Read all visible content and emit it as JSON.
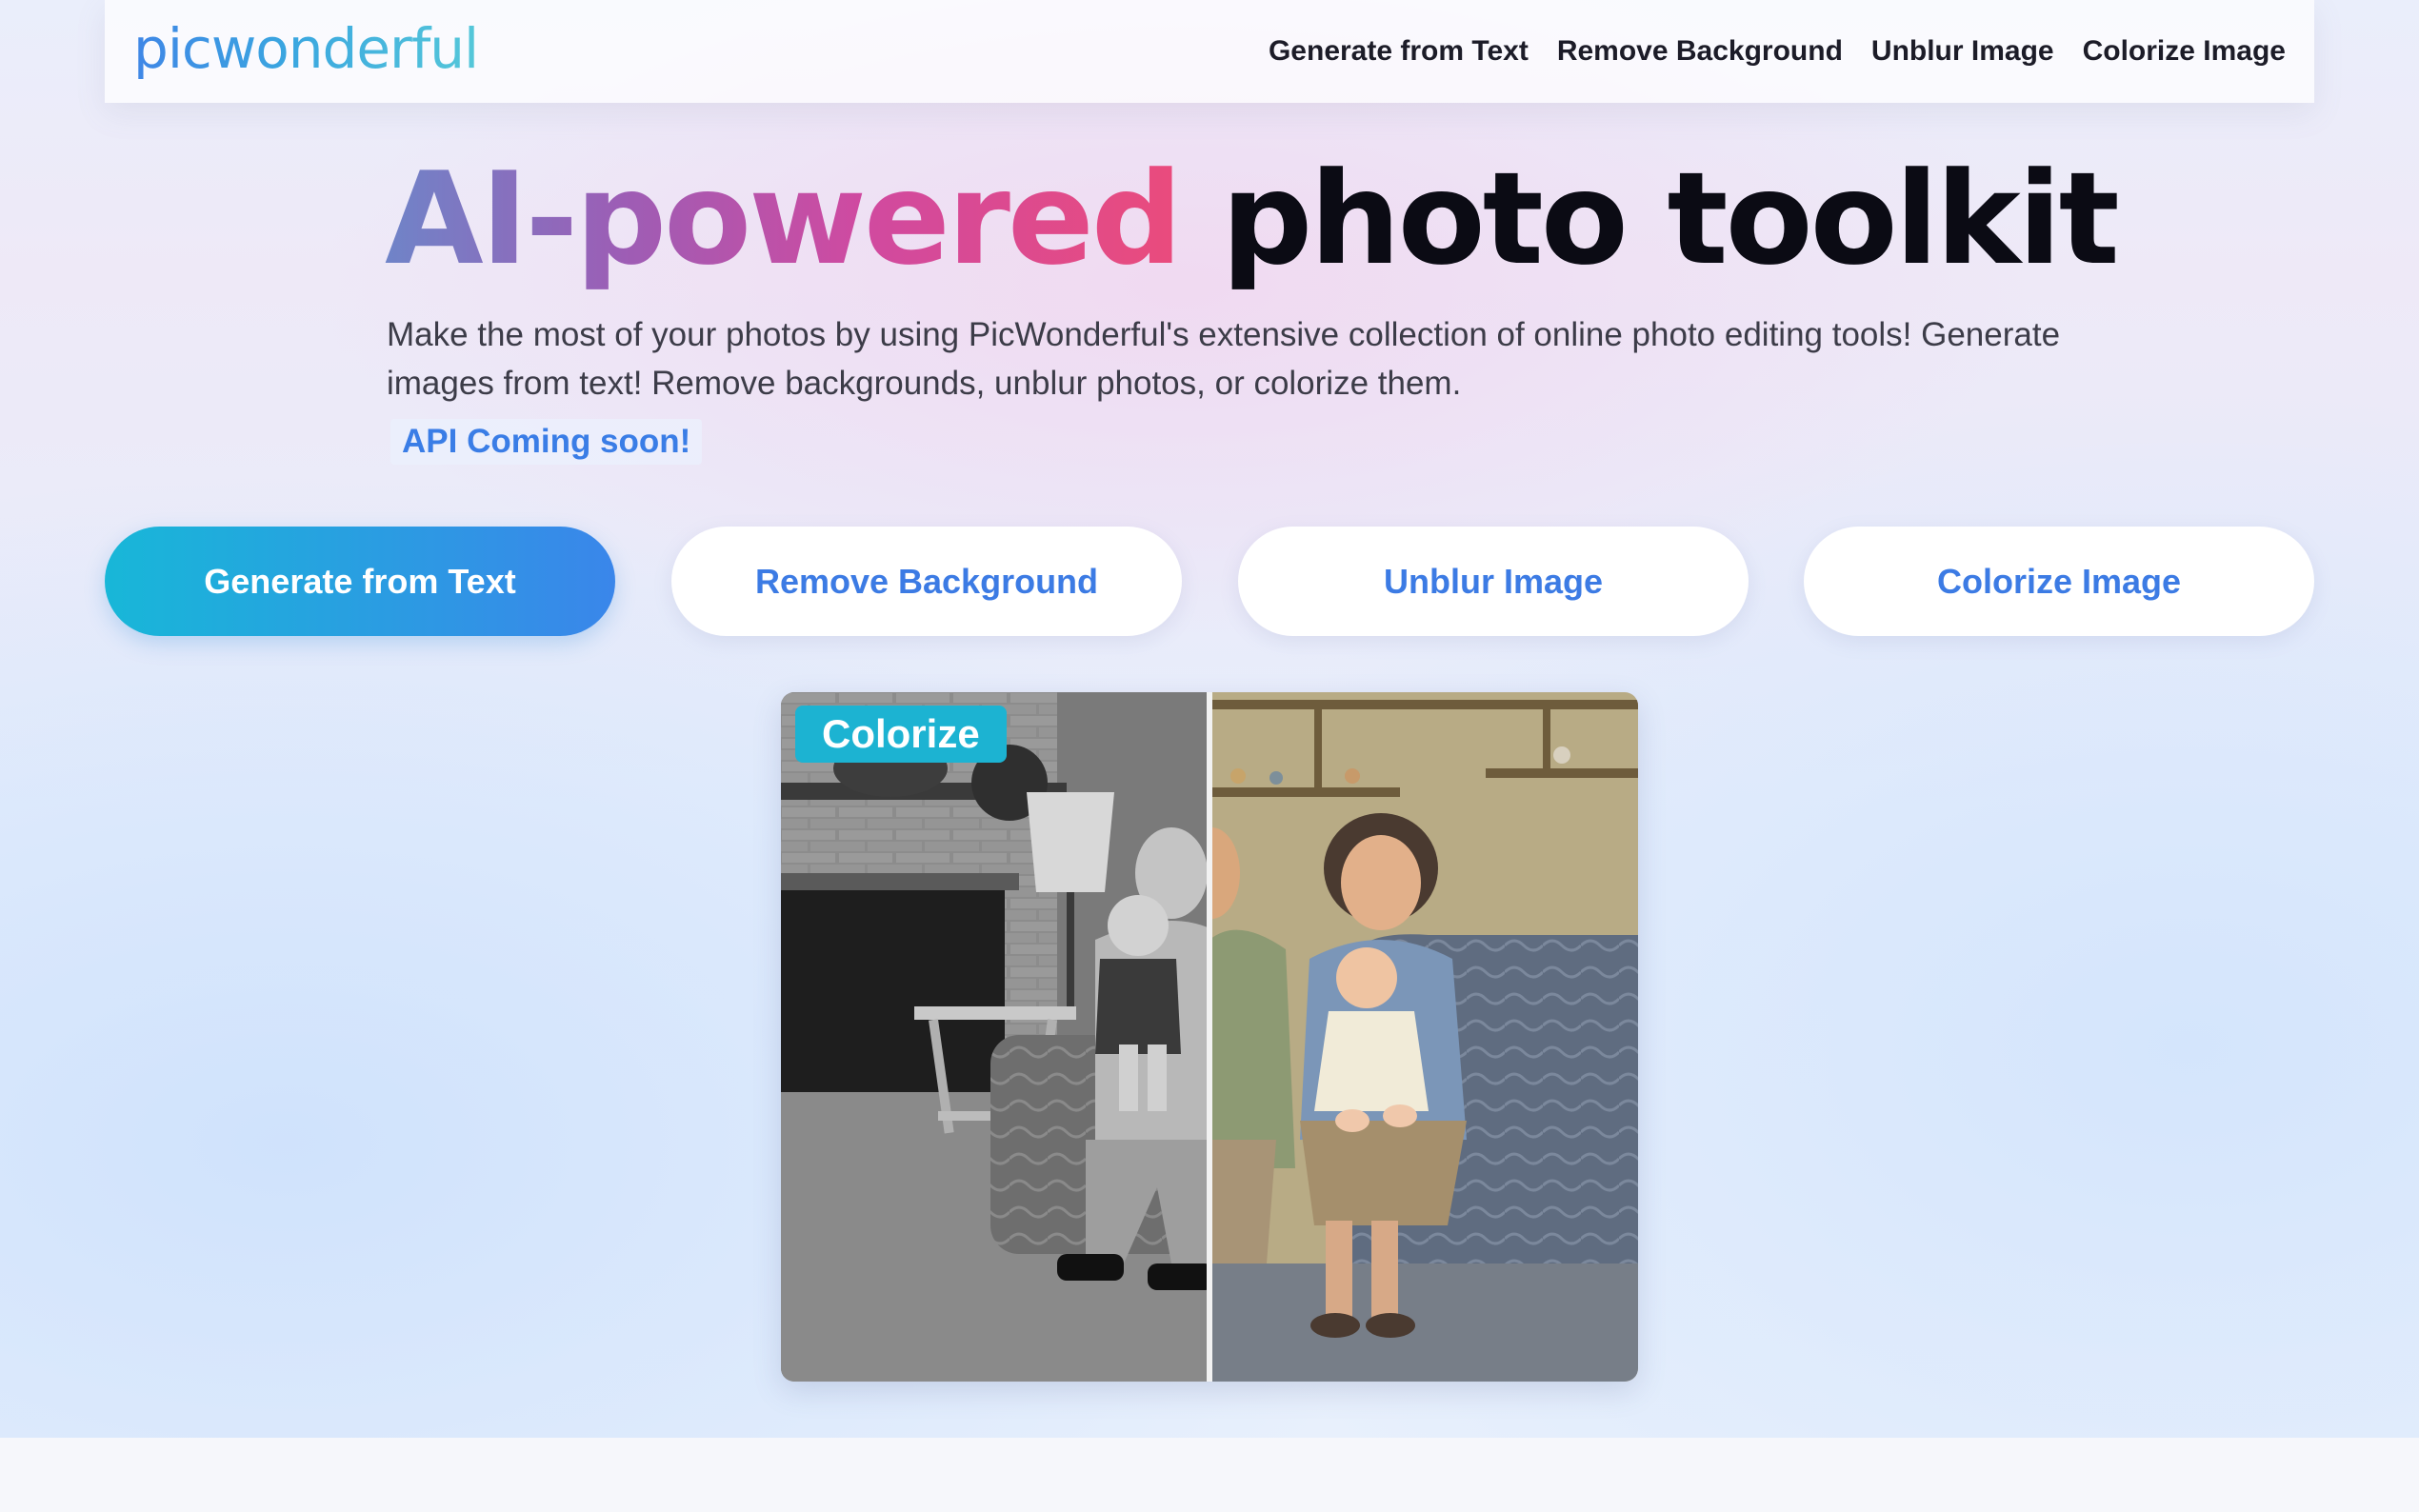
{
  "brand": {
    "logo_text": "picwonderful"
  },
  "nav": {
    "links": [
      "Generate from Text",
      "Remove Background",
      "Unblur Image",
      "Colorize Image"
    ]
  },
  "hero": {
    "title_gradient": "AI-powered",
    "title_plain": "photo toolkit",
    "description": "Make the most of your photos by using PicWonderful's extensive collection of online photo editing tools! Generate images from text! Remove backgrounds, unblur photos, or colorize them.",
    "api_badge": "API Coming soon!"
  },
  "tools": {
    "buttons": [
      "Generate from Text",
      "Remove Background",
      "Unblur Image",
      "Colorize Image"
    ],
    "active_index": 0
  },
  "comparison": {
    "badge": "Colorize",
    "divider_position": 0.5,
    "left_label": "black-and-white original",
    "right_label": "colorized result"
  },
  "colors": {
    "accent_gradient_start": "#18b7d8",
    "accent_gradient_end": "#3a86ea",
    "link_blue": "#3c7be4",
    "title_gradient": [
      "#6f84c8",
      "#9d5db5",
      "#d04aa0",
      "#ea4b7c"
    ]
  }
}
